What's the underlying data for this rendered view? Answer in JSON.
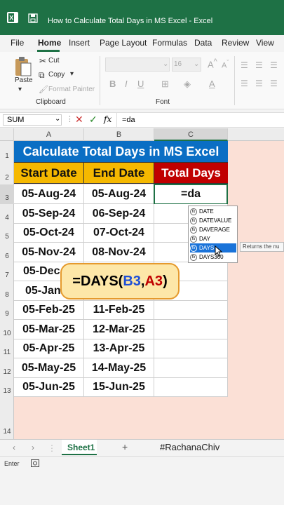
{
  "window": {
    "title": "How to Calculate Total Days in MS Excel  -  Excel"
  },
  "menu": [
    "File",
    "Home",
    "Insert",
    "Page Layout",
    "Formulas",
    "Data",
    "Review",
    "View"
  ],
  "ribbon": {
    "paste": "Paste",
    "cut": "Cut",
    "copy": "Copy",
    "format_painter": "Format Painter",
    "clipboard": "Clipboard",
    "font_size": "16",
    "font": "Font"
  },
  "formula_bar": {
    "name_box": "SUM",
    "fx": "fx",
    "content": "=da"
  },
  "columns": [
    "A",
    "B",
    "C"
  ],
  "rows": [
    "1",
    "2",
    "3",
    "4",
    "5",
    "6",
    "7",
    "8",
    "9",
    "10",
    "11",
    "12",
    "13",
    "14"
  ],
  "sheet": {
    "title": "Calculate Total Days in MS Excel",
    "headers": [
      "Start Date",
      "End Date",
      "Total Days"
    ],
    "editing_cell": "=da",
    "data": [
      [
        "05-Aug-24",
        "05-Aug-24"
      ],
      [
        "05-Sep-24",
        "06-Sep-24"
      ],
      [
        "05-Oct-24",
        "07-Oct-24"
      ],
      [
        "05-Nov-24",
        "08-Nov-24"
      ],
      [
        "05-Dec",
        ""
      ],
      [
        "05-Jan-",
        ""
      ],
      [
        "05-Feb-25",
        "11-Feb-25"
      ],
      [
        "05-Mar-25",
        "12-Mar-25"
      ],
      [
        "05-Apr-25",
        "13-Apr-25"
      ],
      [
        "05-May-25",
        "14-May-25"
      ],
      [
        "05-Jun-25",
        "15-Jun-25"
      ]
    ]
  },
  "autocomplete": {
    "items": [
      "DATE",
      "DATEVALUE",
      "DAVERAGE",
      "DAY",
      "DAYS",
      "DAYS360"
    ],
    "selected": "DAYS",
    "tooltip": "Returns the nu"
  },
  "overlay": {
    "prefix": "=DAYS(",
    "arg1": "B3",
    "comma": ",",
    "arg2": "A3",
    "suffix": ")"
  },
  "tabs": {
    "sheet": "Sheet1",
    "hashtag": "#RachanaChiv"
  },
  "status": {
    "mode": "Enter"
  },
  "colors": {
    "excel_green": "#1e7145",
    "title_bg": "#0a6ec4",
    "header_bg": "#f5b800",
    "total_bg": "#c00000",
    "overlay_bg": "#fde7a8",
    "arg1": "#1f4fd6",
    "arg2": "#c00000"
  }
}
